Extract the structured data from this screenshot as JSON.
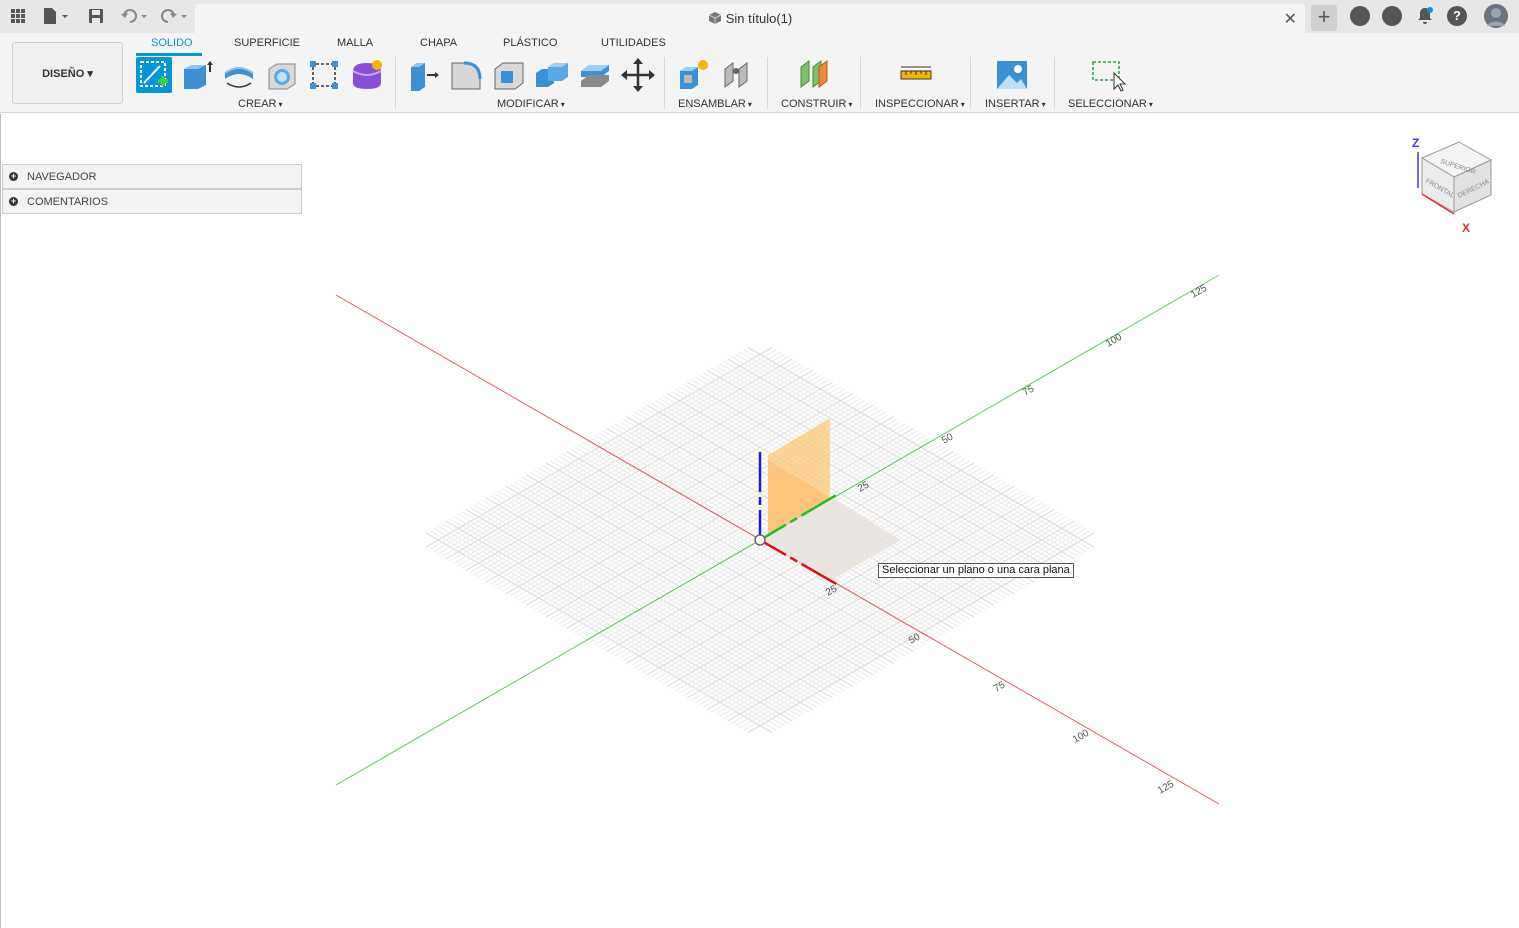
{
  "window": {
    "doc_title": "Sin título(1)",
    "close_glyph": "✕",
    "new_tab_glyph": "+"
  },
  "toolbar": {
    "workspace": "DISEÑO ▾",
    "tabs": [
      "SOLIDO",
      "SUPERFICIE",
      "MALLA",
      "CHAPA",
      "PLÁSTICO",
      "UTILIDADES"
    ],
    "groups": {
      "crear": "CREAR",
      "modificar": "MODIFICAR",
      "ensamblar": "ENSAMBLAR",
      "construir": "CONSTRUIR",
      "inspeccionar": "INSPECCIONAR",
      "insertar": "INSERTAR",
      "seleccionar": "SELECCIONAR"
    },
    "caret": "▾"
  },
  "browser": {
    "navigator": "NAVEGADOR",
    "comments": "COMENTARIOS",
    "expand_glyph": "+"
  },
  "viewcube": {
    "axis_z": "Z",
    "axis_x": "X",
    "face_top": "SUPERIOR",
    "face_front": "FRONTAL",
    "face_right": "DERECHA"
  },
  "grid": {
    "green_axis_labels": [
      "25",
      "50",
      "75",
      "100",
      "125"
    ],
    "red_axis_labels": [
      "25",
      "50",
      "75",
      "100",
      "125"
    ]
  },
  "tooltip": "Seleccionar un plano o una cara plana",
  "colors": {
    "accent": "#0696d7",
    "axis_x": "#e03030",
    "axis_y": "#30c030",
    "axis_z": "#1a1ae0",
    "plane": "#ffc878"
  }
}
